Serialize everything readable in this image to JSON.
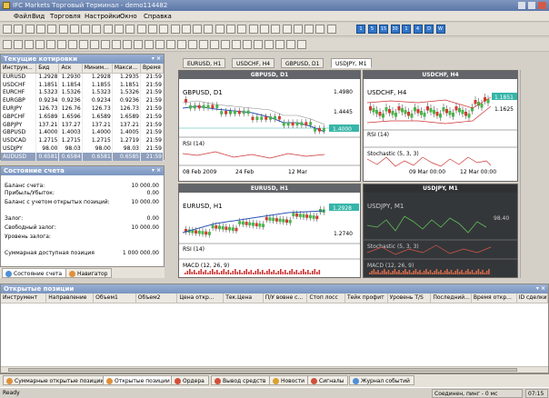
{
  "window": {
    "title": "IFC Markets Торговый Терминал - demo114482"
  },
  "menu": [
    "Файл",
    "Вид",
    "Торговля",
    "Настройки",
    "Окно",
    "Справка"
  ],
  "toolbar_numbers": [
    "1",
    "5",
    "15",
    "30",
    "1",
    "4",
    "D",
    "W"
  ],
  "quotes_panel": {
    "title": "Текущие котировки",
    "columns": [
      "Инструм...",
      "Бид",
      "Аск",
      "Миним...",
      "Макси...",
      "Время"
    ],
    "rows": [
      {
        "symbol": "EURUSD",
        "bid": "1.2928",
        "ask": "1.2930",
        "min": "1.2928",
        "max": "1.2935",
        "time": "21:59"
      },
      {
        "symbol": "USDCHF",
        "bid": "1.1851",
        "ask": "1.1854",
        "max": "1.1851",
        "min": "1.1855",
        "time": "21:59"
      },
      {
        "symbol": "EURCHF",
        "bid": "1.5323",
        "ask": "1.5326",
        "min": "1.5323",
        "max": "1.5326",
        "time": "21:59"
      },
      {
        "symbol": "EURGBP",
        "bid": "0.9234",
        "ask": "0.9236",
        "min": "0.9234",
        "max": "0.9236",
        "time": "21:59"
      },
      {
        "symbol": "EURJPY",
        "bid": "126.73",
        "ask": "126.76",
        "min": "126.73",
        "max": "126.73",
        "time": "21:59"
      },
      {
        "symbol": "GBPCHF",
        "bid": "1.6589",
        "ask": "1.6596",
        "min": "1.6589",
        "max": "1.6589",
        "time": "21:59"
      },
      {
        "symbol": "GBPJPY",
        "bid": "137.21",
        "ask": "137.27",
        "min": "137.21",
        "max": "137.21",
        "time": "21:59"
      },
      {
        "symbol": "GBPUSD",
        "bid": "1.4000",
        "ask": "1.4003",
        "min": "1.4000",
        "max": "1.4005",
        "time": "21:59"
      },
      {
        "symbol": "USDCAD",
        "bid": "1.2715",
        "ask": "1.2715",
        "min": "1.2715",
        "max": "1.2719",
        "time": "21:59"
      },
      {
        "symbol": "USDJPY",
        "bid": "98.00",
        "ask": "98.03",
        "min": "98.00",
        "max": "98.03",
        "time": "21:59"
      },
      {
        "symbol": "AUDUSD",
        "bid": "0.6581",
        "ask": "0.6584",
        "min": "0.6581",
        "max": "0.6585",
        "time": "21:59"
      }
    ],
    "selected_row": 10
  },
  "account_panel": {
    "title": "Состояние счета",
    "rows": [
      {
        "label": "Баланс счета:",
        "value": "10 000.00"
      },
      {
        "label": "Прибыль/Убыток:",
        "value": "0.00"
      },
      {
        "label": "Баланс с учетом открытых позиций:",
        "value": "10 000.00"
      },
      {
        "label": "Залог:",
        "value": "0.00"
      },
      {
        "label": "Свободный залог:",
        "value": "10 000.00"
      },
      {
        "label": "Уровень залога:",
        "value": ""
      },
      {
        "label": "Суммарная доступная позиция",
        "value": "1 000 000.00"
      }
    ],
    "tabs": [
      "Состояние счета",
      "Навигатор"
    ]
  },
  "chart_tabs": [
    "EURUSD, H1",
    "USDCHF, H4",
    "GBPUSD, D1",
    "USDJPY, M1"
  ],
  "chart_tab_active": 3,
  "charts": [
    {
      "title": "GBPUSD, D1",
      "label": "GBPUSD, D1",
      "price_marker": "1.4000",
      "y_labels": [
        "1.4980",
        "1.4445",
        "1.4000"
      ],
      "sub_label": "RSI (14)",
      "x_labels": [
        "08 Feb 2009",
        "24 Feb",
        "12 Mar"
      ]
    },
    {
      "title": "USDCHF, H4",
      "label": "USDCHF, H4",
      "price_marker": "1.1851",
      "y_labels": [
        "1.1625"
      ],
      "sub_label": "RSI (14)",
      "sub_label2": "Stochastic (5, 3, 3)",
      "x_labels": [
        "09 Mar 00:00",
        "12 Mar 00:00"
      ]
    },
    {
      "title": "EURUSD, H1",
      "label": "EURUSD, H1",
      "price_marker": "1.2928",
      "y_labels": [
        "1.2740"
      ],
      "sub_label": "RSI (14)",
      "sub_label2": "MACD (12, 26, 9)"
    },
    {
      "title": "USDJPY, M1",
      "label": "USDJPY, M1",
      "y_labels": [
        "98.40"
      ],
      "sub_label": "Stochastic (5, 3, 3)",
      "sub_label2": "MACD (12, 26, 9)"
    }
  ],
  "positions_panel": {
    "title": "Открытые позиции",
    "columns": [
      "Инструмент",
      "Направление",
      "Объем1",
      "Объем2",
      "Цена откр...",
      "Тек.Цена",
      "П/У вовне с...",
      "Стоп лосс",
      "Тейк профит",
      "Уровень T/S",
      "Последний...",
      "Время откр...",
      "ID сделки"
    ]
  },
  "bottom_tabs": [
    "Суммарные открытые позиции",
    "Открытые позиции",
    "Ордера",
    "Вывод средств",
    "Новости",
    "Сигналы",
    "Журнал событий"
  ],
  "bottom_tab_active": 1,
  "status": {
    "left": "Ready",
    "connection": "Соединен, пинг - 0 мс",
    "time": "07:15"
  },
  "colors": {
    "accent": "#2f74c9",
    "panel_header": "#7a95c0",
    "chart_bg": "#ffffff",
    "dark_chart_bg": "#34373a",
    "price_marker": "#36b5a8"
  }
}
